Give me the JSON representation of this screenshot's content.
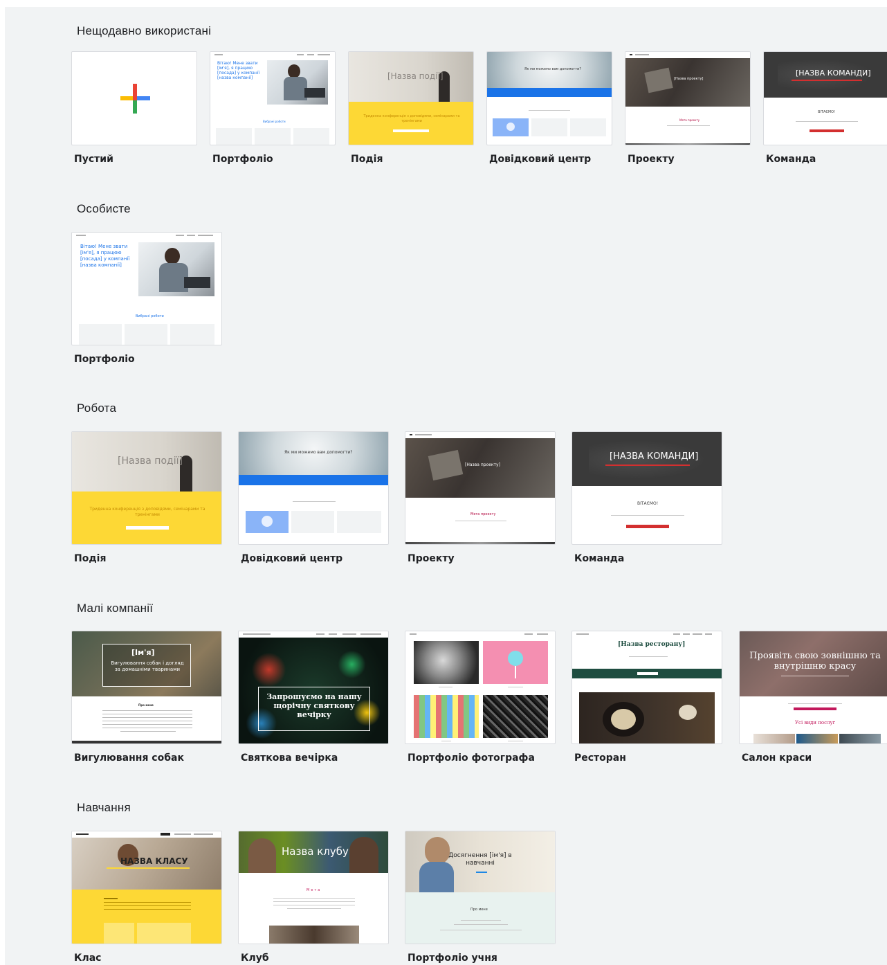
{
  "sections": [
    {
      "title": "Нещодавно використані",
      "items": [
        {
          "label": "Пустий"
        },
        {
          "label": "Портфоліо",
          "preview": {
            "headline": "Вітаю! Мене звати [ім'я], я працюю [посада] у компанії [назва компанії]",
            "cta": "Вибрані роботи"
          }
        },
        {
          "label": "Подія",
          "preview": {
            "headline": "[Назва події]",
            "sub": "Триденна конференція з доповідями, семінарами та тренінгами"
          }
        },
        {
          "label": "Довідковий центр",
          "preview": {
            "headline": "Як ми можемо вам допомогти?"
          }
        },
        {
          "label": "Проекту",
          "preview": {
            "headline": "[Назва проекту]",
            "sub": "Мета проекту"
          }
        },
        {
          "label": "Команда",
          "preview": {
            "headline": "[НАЗВА КОМАНДИ]",
            "sub": "ВІТАЄМО!"
          }
        }
      ]
    },
    {
      "title": "Особисте",
      "items": [
        {
          "label": "Портфоліо",
          "preview": {
            "headline": "Вітаю! Мене звати [ім'я], я працюю [посада] у компанії [назва компанії]",
            "cta": "Вибрані роботи"
          }
        }
      ]
    },
    {
      "title": "Робота",
      "items": [
        {
          "label": "Подія",
          "preview": {
            "headline": "[Назва події]",
            "sub": "Триденна конференція з доповідями, семінарами та тренінгами"
          }
        },
        {
          "label": "Довідковий центр",
          "preview": {
            "headline": "Як ми можемо вам допомогти?"
          }
        },
        {
          "label": "Проекту",
          "preview": {
            "headline": "[Назва проекту]",
            "sub": "Мета проекту"
          }
        },
        {
          "label": "Команда",
          "preview": {
            "headline": "[НАЗВА КОМАНДИ]",
            "sub": "ВІТАЄМО!"
          }
        }
      ]
    },
    {
      "title": "Малі компанії",
      "items": [
        {
          "label": "Вигулювання собак",
          "preview": {
            "headline": "[Ім'я]",
            "sub": "Вигулювання собак і догляд за домашніми тваринами",
            "sub2": "Про мене"
          }
        },
        {
          "label": "Святкова вечірка",
          "preview": {
            "headline": "Запрошуємо на нашу щорічну святкову вечірку"
          }
        },
        {
          "label": "Портфоліо фотографа"
        },
        {
          "label": "Ресторан",
          "preview": {
            "headline": "[Назва ресторану]"
          }
        },
        {
          "label": "Салон краси",
          "preview": {
            "headline": "Проявіть свою зовнішню та внутрішню красу",
            "sub": "Усі види послуг"
          }
        }
      ]
    },
    {
      "title": "Навчання",
      "items": [
        {
          "label": "Клас",
          "preview": {
            "headline": "НАЗВА КЛАСУ"
          }
        },
        {
          "label": "Клуб",
          "preview": {
            "headline": "Назва клубу",
            "sub": "Мета"
          }
        },
        {
          "label": "Портфоліо учня",
          "preview": {
            "headline": "Досягнення [ім'я] в навчанні",
            "sub": "Про мене"
          }
        }
      ]
    }
  ],
  "colors": {
    "event_yellow": "#fdd835",
    "help_blue": "#1a73e8",
    "team_red": "#d32f2f",
    "restaurant_green": "#1e4d40",
    "beauty_pink": "#c2185b"
  }
}
